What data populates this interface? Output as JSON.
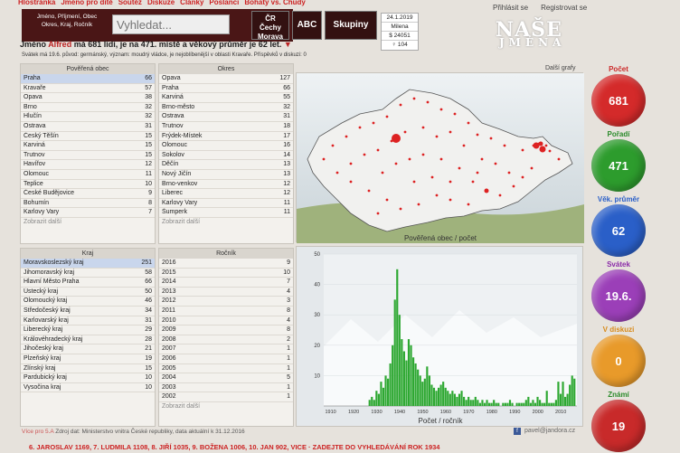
{
  "nav": {
    "items": [
      "Hlostránka",
      "Jméno pro dítě",
      "Soutěž",
      "Diskuze",
      "Články",
      "Poslanci",
      "Bohatý vs. Chudý"
    ]
  },
  "account": {
    "login": "Přihlásit se",
    "register": "Registrovat se"
  },
  "brand": {
    "line1": "NAŠE",
    "line2": "JMÉNA"
  },
  "search": {
    "label_lines": [
      "Jméno, Příjmení, Obec",
      "Okres, Kraj, Ročník"
    ],
    "placeholder": "Vyhledat..."
  },
  "buttons": {
    "cr_line1": "ČR",
    "cr_line2": "Čechy",
    "cr_line3": "Morava",
    "abc": "ABC",
    "skupiny": "Skupiny"
  },
  "date_box": {
    "date": "24.1.2019",
    "name": "Milena",
    "count1": "24051",
    "count2": "104",
    "count1_symbol": "$",
    "count2_symbol": "♀"
  },
  "summary": {
    "p1": "Jméno ",
    "name": "Alfred",
    "p2": " má 681 lidí, je na 471. místě a věkový průměr je 62 let.",
    "arrow": "▼"
  },
  "subline": "Svátek má 19.6. původ: germánský, význam: moudrý vládce, je nejoblíbenější v oblasti Kravaře. Příspěvků v diskuzi: 0",
  "more_charts": "Další grafy",
  "obec": {
    "title": "Pověřená obec",
    "more": "Zobrazit další",
    "rows": [
      [
        "Praha",
        "66"
      ],
      [
        "Kravaře",
        "57"
      ],
      [
        "Opava",
        "38"
      ],
      [
        "Brno",
        "32"
      ],
      [
        "Hlučín",
        "32"
      ],
      [
        "Ostrava",
        "31"
      ],
      [
        "Český Těšín",
        "15"
      ],
      [
        "Karviná",
        "15"
      ],
      [
        "Trutnov",
        "15"
      ],
      [
        "Havířov",
        "12"
      ],
      [
        "Olomouc",
        "11"
      ],
      [
        "Teplice",
        "10"
      ],
      [
        "České Budějovice",
        "9"
      ],
      [
        "Bohumín",
        "8"
      ],
      [
        "Karlovy Vary",
        "7"
      ]
    ]
  },
  "okres": {
    "title": "Okres",
    "more": "Zobrazit další",
    "rows": [
      [
        "Opava",
        "127"
      ],
      [
        "Praha",
        "66"
      ],
      [
        "Karviná",
        "55"
      ],
      [
        "Brno-město",
        "32"
      ],
      [
        "Ostrava",
        "31"
      ],
      [
        "Trutnov",
        "18"
      ],
      [
        "Frýdek-Místek",
        "17"
      ],
      [
        "Olomouc",
        "16"
      ],
      [
        "Sokolov",
        "14"
      ],
      [
        "Děčín",
        "13"
      ],
      [
        "Nový Jičín",
        "13"
      ],
      [
        "Brno-venkov",
        "12"
      ],
      [
        "Liberec",
        "12"
      ],
      [
        "Karlovy Vary",
        "11"
      ],
      [
        "Šumperk",
        "11"
      ]
    ]
  },
  "kraj": {
    "title": "Kraj",
    "rows": [
      [
        "Moravskoslezský kraj",
        "251"
      ],
      [
        "Jihomoravský kraj",
        "58"
      ],
      [
        "Hlavní Město Praha",
        "66"
      ],
      [
        "Ústecký kraj",
        "50"
      ],
      [
        "Olomoucký kraj",
        "46"
      ],
      [
        "Středočeský kraj",
        "34"
      ],
      [
        "Karlovarský kraj",
        "31"
      ],
      [
        "Liberecký kraj",
        "29"
      ],
      [
        "Královéhradecký kraj",
        "28"
      ],
      [
        "Jihočeský kraj",
        "21"
      ],
      [
        "Plzeňský kraj",
        "19"
      ],
      [
        "Zlínský kraj",
        "15"
      ],
      [
        "Pardubický kraj",
        "10"
      ],
      [
        "Vysočina kraj",
        "10"
      ]
    ]
  },
  "rocnik": {
    "title": "Ročník",
    "more": "Zobrazit další",
    "rows": [
      [
        "2016",
        "9"
      ],
      [
        "2015",
        "10"
      ],
      [
        "2014",
        "7"
      ],
      [
        "2013",
        "4"
      ],
      [
        "2012",
        "3"
      ],
      [
        "2011",
        "8"
      ],
      [
        "2010",
        "4"
      ],
      [
        "2009",
        "8"
      ],
      [
        "2008",
        "2"
      ],
      [
        "2007",
        "1"
      ],
      [
        "2006",
        "1"
      ],
      [
        "2005",
        "1"
      ],
      [
        "2004",
        "5"
      ],
      [
        "2003",
        "1"
      ],
      [
        "2002",
        "1"
      ]
    ]
  },
  "map": {
    "caption": "Pověřená obec / počet"
  },
  "chart_data": {
    "type": "bar",
    "title": "",
    "xlabel": "Počet / ročník",
    "ylabel": "",
    "ylim": [
      0,
      50
    ],
    "yticks": [
      0,
      10,
      20,
      30,
      40,
      50
    ],
    "xticks": [
      1910,
      1920,
      1930,
      1940,
      1950,
      1960,
      1970,
      1980,
      1990,
      2000,
      2010
    ],
    "x": [
      1927,
      1928,
      1929,
      1930,
      1931,
      1932,
      1933,
      1934,
      1935,
      1936,
      1937,
      1938,
      1939,
      1940,
      1941,
      1942,
      1943,
      1944,
      1945,
      1946,
      1947,
      1948,
      1949,
      1950,
      1951,
      1952,
      1953,
      1954,
      1955,
      1956,
      1957,
      1958,
      1959,
      1960,
      1961,
      1962,
      1963,
      1964,
      1965,
      1966,
      1967,
      1968,
      1969,
      1970,
      1971,
      1972,
      1973,
      1974,
      1975,
      1976,
      1977,
      1978,
      1979,
      1980,
      1981,
      1982,
      1983,
      1984,
      1985,
      1986,
      1987,
      1988,
      1989,
      1990,
      1991,
      1992,
      1993,
      1994,
      1995,
      1996,
      1997,
      1998,
      1999,
      2000,
      2001,
      2002,
      2003,
      2004,
      2005,
      2006,
      2007,
      2008,
      2009,
      2010,
      2011,
      2012,
      2013,
      2014,
      2015,
      2016
    ],
    "values": [
      2,
      3,
      2,
      5,
      4,
      8,
      6,
      10,
      9,
      14,
      20,
      35,
      45,
      30,
      22,
      18,
      15,
      22,
      20,
      16,
      14,
      12,
      10,
      8,
      9,
      13,
      10,
      7,
      6,
      5,
      6,
      7,
      8,
      6,
      5,
      4,
      5,
      4,
      3,
      4,
      5,
      3,
      2,
      3,
      2,
      2,
      3,
      2,
      1,
      2,
      1,
      2,
      1,
      1,
      2,
      1,
      1,
      0,
      1,
      1,
      1,
      2,
      1,
      0,
      1,
      1,
      1,
      1,
      2,
      3,
      1,
      2,
      1,
      3,
      2,
      1,
      1,
      5,
      1,
      1,
      1,
      2,
      8,
      4,
      8,
      3,
      4,
      7,
      10,
      9
    ],
    "color": "#2ea832"
  },
  "stats": [
    {
      "label": "Počet",
      "value": "681",
      "color": "#d42a2a",
      "label_color": "#cc2a2a"
    },
    {
      "label": "Pořadí",
      "value": "471",
      "color": "#2d9c2d",
      "label_color": "#2a8a2a"
    },
    {
      "label": "Věk. průměr",
      "value": "62",
      "color": "#2a5fc8",
      "label_color": "#2a5fc8"
    },
    {
      "label": "Svátek",
      "value": "19.6.",
      "color": "#9b3fb8",
      "label_color": "#8a2aa8"
    },
    {
      "label": "V diskuzi",
      "value": "0",
      "color": "#e89a2a",
      "label_color": "#d88a1a"
    },
    {
      "label": "Známí",
      "value": "19",
      "color": "#c82a2a",
      "label_color": "#2a8a2a"
    }
  ],
  "footer": {
    "prefix": "Více pro 5.A",
    "source": " Zdroj dat: Ministerstvo vnitra České republiky, data aktuální k 31.12.2016"
  },
  "email": "pavel@jandora.cz",
  "bottom_names": "6. JAROSLAV 1169, 7. LUDMILA 1108, 8. JIŘÍ 1035, 9. BOŽENA 1006, 10. JAN 902, VICE · ZADEJTE DO VYHLEDÁVÁNÍ ROK 1934"
}
